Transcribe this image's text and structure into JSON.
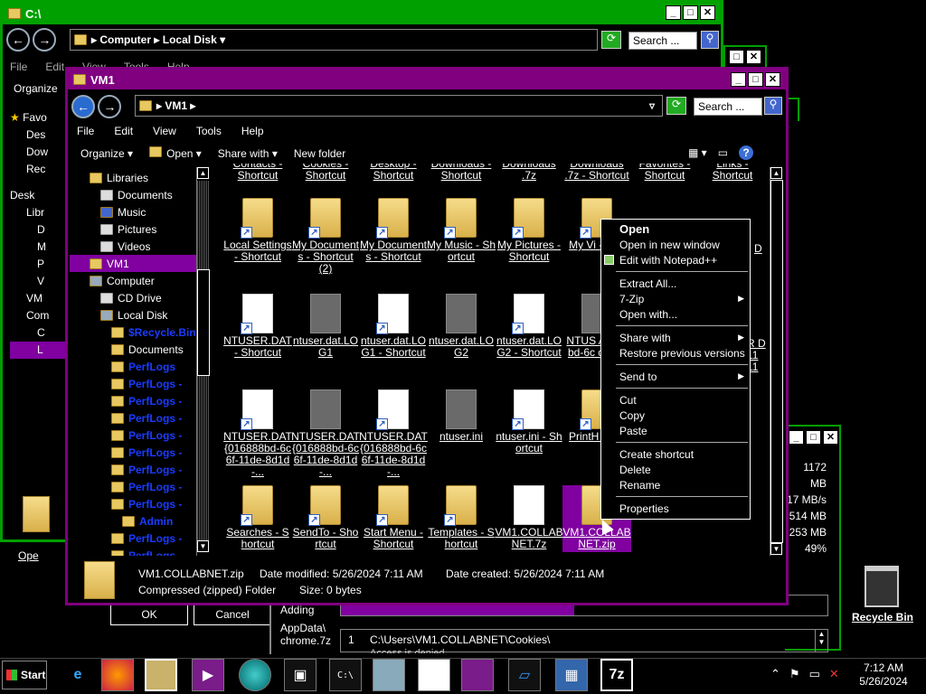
{
  "back_window": {
    "title": "C:\\",
    "address": [
      "Computer",
      "Local Disk"
    ],
    "search_placeholder": "Search ...",
    "menu": [
      "File",
      "Edit",
      "View",
      "Tools",
      "Help"
    ],
    "organize": "Organize",
    "side_items": [
      "Favo",
      "Des",
      "Dow",
      "Rec",
      "Desk",
      "Libr",
      "D",
      "M",
      "P",
      "V",
      "VM",
      "Com",
      "C",
      "L"
    ],
    "open_label": "Ope"
  },
  "dialog": {
    "ok": "OK",
    "cancel": "Cancel",
    "adding": "Adding",
    "appdata": "AppData\\",
    "chrome": "chrome.7z",
    "list_index": "1",
    "list_path": "C:\\Users\\VM1.COLLABNET\\Cookies\\",
    "list_status": "Access is denied."
  },
  "stats_window": {
    "values": [
      "1172 MB",
      "17 MB/s",
      "514 MB",
      "253 MB",
      "49%"
    ]
  },
  "main_window": {
    "title": "VM1",
    "address": "VM1",
    "search_placeholder": "Search ...",
    "menu": [
      "File",
      "Edit",
      "View",
      "Tools",
      "Help"
    ],
    "toolbar": {
      "organize": "Organize",
      "open": "Open",
      "share_with": "Share with",
      "new_folder": "New folder"
    },
    "nav": [
      {
        "label": "Libraries",
        "indent": 1,
        "type": "lib"
      },
      {
        "label": "Documents",
        "indent": 2,
        "type": "doc"
      },
      {
        "label": "Music",
        "indent": 2,
        "type": "music"
      },
      {
        "label": "Pictures",
        "indent": 2,
        "type": "pic"
      },
      {
        "label": "Videos",
        "indent": 2,
        "type": "vid"
      },
      {
        "label": "VM1",
        "indent": 1,
        "type": "user",
        "selected": true
      },
      {
        "label": "Computer",
        "indent": 1,
        "type": "comp"
      },
      {
        "label": "CD Drive",
        "indent": 2,
        "type": "cd"
      },
      {
        "label": "Local Disk",
        "indent": 2,
        "type": "disk"
      },
      {
        "label": "$Recycle.Bin",
        "indent": 3,
        "type": "folder",
        "blue": true
      },
      {
        "label": "Documents",
        "indent": 3,
        "type": "folder"
      },
      {
        "label": "PerfLogs",
        "indent": 3,
        "type": "folder",
        "blue": true
      },
      {
        "label": "PerfLogs - ",
        "indent": 3,
        "type": "folder",
        "blue": true
      },
      {
        "label": "PerfLogs - ",
        "indent": 3,
        "type": "folder",
        "blue": true
      },
      {
        "label": "PerfLogs - ",
        "indent": 3,
        "type": "folder",
        "blue": true
      },
      {
        "label": "PerfLogs - ",
        "indent": 3,
        "type": "folder",
        "blue": true
      },
      {
        "label": "PerfLogs - ",
        "indent": 3,
        "type": "folder",
        "blue": true
      },
      {
        "label": "PerfLogs - ",
        "indent": 3,
        "type": "folder",
        "blue": true
      },
      {
        "label": "PerfLogs - ",
        "indent": 3,
        "type": "folder",
        "blue": true
      },
      {
        "label": "PerfLogs - ",
        "indent": 3,
        "type": "folder",
        "blue": true
      },
      {
        "label": "Admin",
        "indent": 4,
        "type": "folder",
        "blue": true
      },
      {
        "label": "PerfLogs - ",
        "indent": 3,
        "type": "folder",
        "blue": true
      },
      {
        "label": "PerfLogs - ",
        "indent": 3,
        "type": "folder",
        "blue": true
      }
    ],
    "files_row0": [
      "Contacts - Shortcut",
      "Cookies - Shortcut",
      "Desktop - Shortcut",
      "Downloads - Shortcut",
      "Downloads .7z",
      "Downloads .7z - Shortcut",
      "Favorites - Shortcut",
      "Links - Shortcut"
    ],
    "files": [
      {
        "label": "Local Settings - Shortcut",
        "icon": "folder",
        "sc": true
      },
      {
        "label": "My Documents - Shortcut (2)",
        "icon": "folder",
        "sc": true
      },
      {
        "label": "My Documents - Shortcut",
        "icon": "folder",
        "sc": true
      },
      {
        "label": "My Music - Shortcut",
        "icon": "folder",
        "sc": true
      },
      {
        "label": "My Pictures - Shortcut",
        "icon": "folder",
        "sc": true
      },
      {
        "label": "My Vi - Sho",
        "icon": "folder",
        "sc": true
      },
      {
        "label": "NTUSER.DAT - Shortcut",
        "icon": "white",
        "sc": true
      },
      {
        "label": "ntuser.dat.LOG1",
        "icon": "gray",
        "sc": false
      },
      {
        "label": "ntuser.dat.LOG1 - Shortcut",
        "icon": "white",
        "sc": true
      },
      {
        "label": "ntuser.dat.LOG2",
        "icon": "gray",
        "sc": false
      },
      {
        "label": "ntuser.dat.LOG2 - Shortcut",
        "icon": "white",
        "sc": true
      },
      {
        "label": "NTUS AT{01 bd-6c de-8d",
        "icon": "gray",
        "sc": false
      },
      {
        "label": "NTUSER.DAT{016888bd-6c6f-11de-8d1d-...",
        "icon": "white",
        "sc": true
      },
      {
        "label": "NTUSER.DAT{016888bd-6c6f-11de-8d1d-...",
        "icon": "gray",
        "sc": false
      },
      {
        "label": "NTUSER.DAT{016888bd-6c6f-11de-8d1d-...",
        "icon": "white",
        "sc": true
      },
      {
        "label": "ntuser.ini",
        "icon": "gray",
        "sc": false
      },
      {
        "label": "ntuser.ini - Shortcut",
        "icon": "white",
        "sc": true
      },
      {
        "label": "PrintH Shor",
        "icon": "folder",
        "sc": true
      },
      {
        "label": "Searches - Shortcut",
        "icon": "folder",
        "sc": true
      },
      {
        "label": "SendTo - Shortcut",
        "icon": "folder",
        "sc": true
      },
      {
        "label": "Start Menu - Shortcut",
        "icon": "folder",
        "sc": true
      },
      {
        "label": "Templates - Shortcut",
        "icon": "folder",
        "sc": true
      },
      {
        "label": "VM1.COLLABNET.7z",
        "icon": "white",
        "sc": false
      },
      {
        "label": "VM1.COLLABNET.zip",
        "icon": "folder",
        "sc": false,
        "selected": true
      }
    ],
    "right_partial": [
      "D",
      "R D",
      "11",
      "11"
    ],
    "details": {
      "name": "VM1.COLLABNET.zip",
      "type": "Compressed (zipped) Folder",
      "modified_label": "Date modified:",
      "modified": "5/26/2024 7:11 AM",
      "created_label": "Date created:",
      "created": "5/26/2024 7:11 AM",
      "size_label": "Size:",
      "size": "0 bytes"
    }
  },
  "context_menu": {
    "open": "Open",
    "open_new_window": "Open in new window",
    "edit_notepad": "Edit with Notepad++",
    "extract_all": "Extract All...",
    "seven_zip": "7-Zip",
    "open_with": "Open with...",
    "share_with": "Share with",
    "restore_prev": "Restore previous versions",
    "send_to": "Send to",
    "cut": "Cut",
    "copy": "Copy",
    "paste": "Paste",
    "create_shortcut": "Create shortcut",
    "delete": "Delete",
    "rename": "Rename",
    "properties": "Properties"
  },
  "desktop": {
    "recycle_bin": "Recycle Bin"
  },
  "taskbar": {
    "start": "Start",
    "time": "7:12 AM",
    "date": "5/26/2024"
  },
  "colors": {
    "green_title": "#00a000",
    "purple_title": "#800080",
    "selected": "#8000a0"
  }
}
